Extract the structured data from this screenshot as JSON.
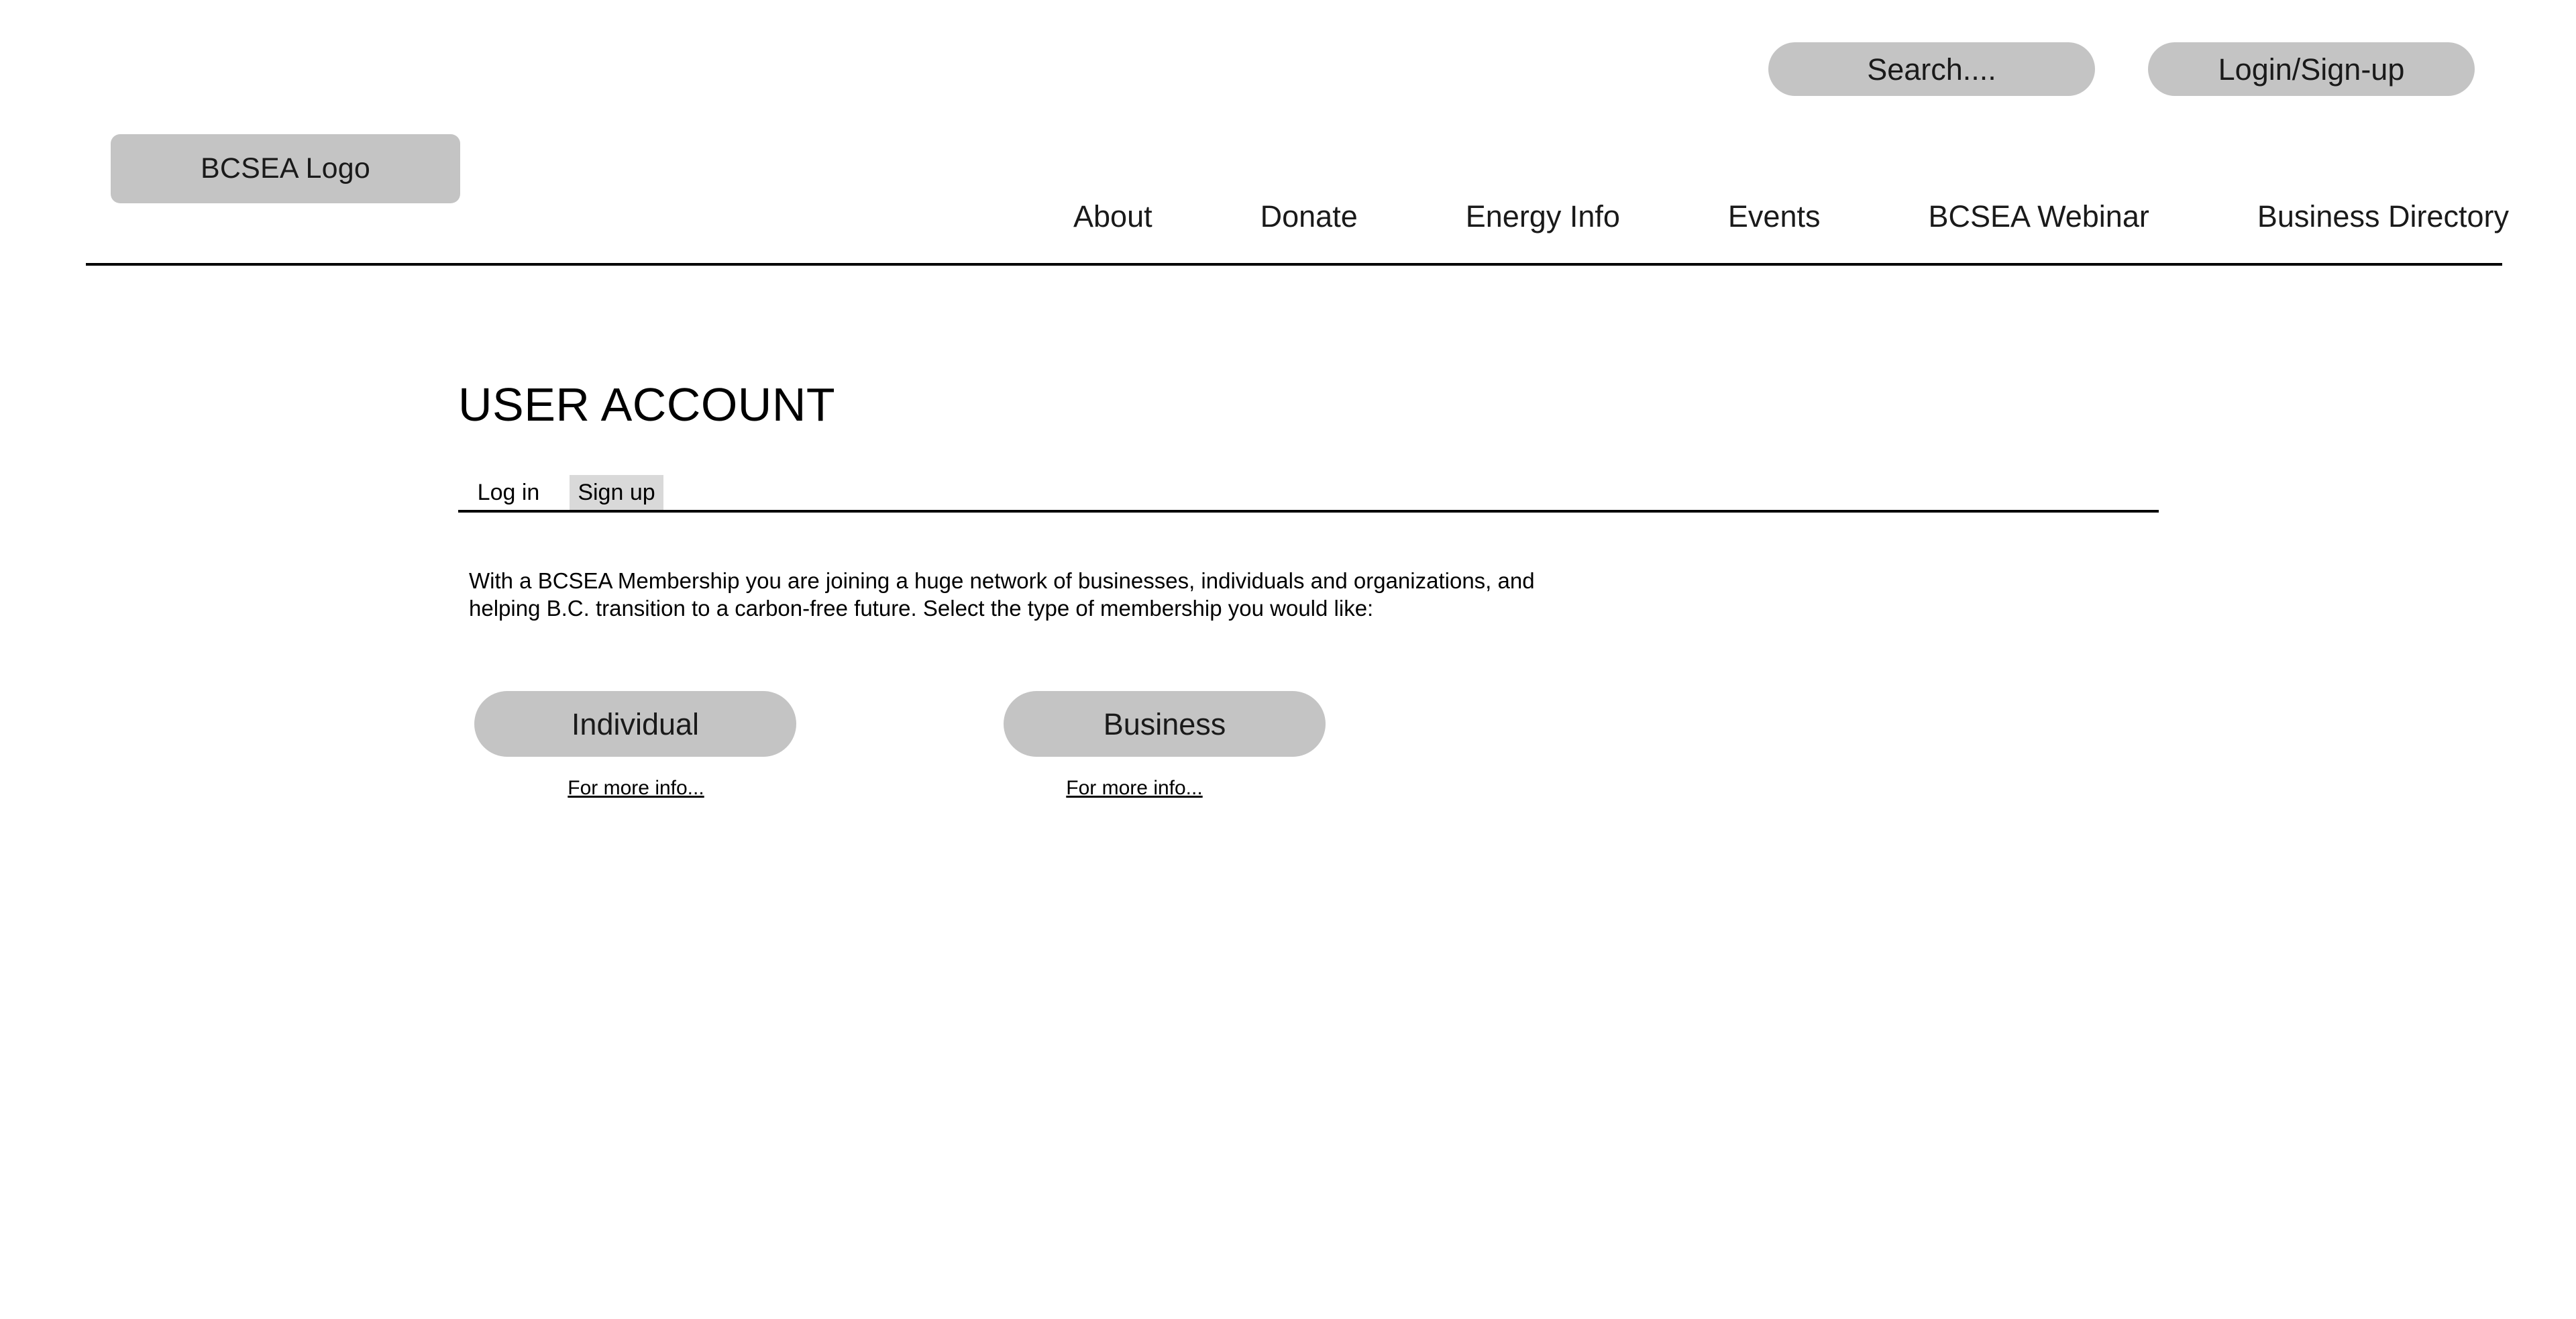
{
  "header": {
    "logo_label": "BCSEA Logo",
    "search_label": "Search....",
    "login_label": "Login/Sign-up",
    "nav": [
      {
        "label": "About"
      },
      {
        "label": "Donate"
      },
      {
        "label": "Energy Info"
      },
      {
        "label": "Events"
      },
      {
        "label": "BCSEA Webinar"
      },
      {
        "label": "Business Directory"
      }
    ]
  },
  "main": {
    "page_title": "USER ACCOUNT",
    "tabs": [
      {
        "label": "Log in",
        "active": false
      },
      {
        "label": "Sign up",
        "active": true
      }
    ],
    "intro_paragraph": "With a BCSEA Membership you are joining a huge network of businesses, individuals and organizations, and helping B.C. transition to a carbon-free future. Select the type of membership you would like:",
    "membership_options": [
      {
        "label": "Individual",
        "more_info_label": "For more info..."
      },
      {
        "label": "Business",
        "more_info_label": "For more info..."
      }
    ]
  },
  "colors": {
    "page_background": "#ffffff",
    "pill_fill": "#c4c4c4",
    "active_tab_fill": "#d9d9d9",
    "text": "#000000",
    "rule": "#000000"
  }
}
